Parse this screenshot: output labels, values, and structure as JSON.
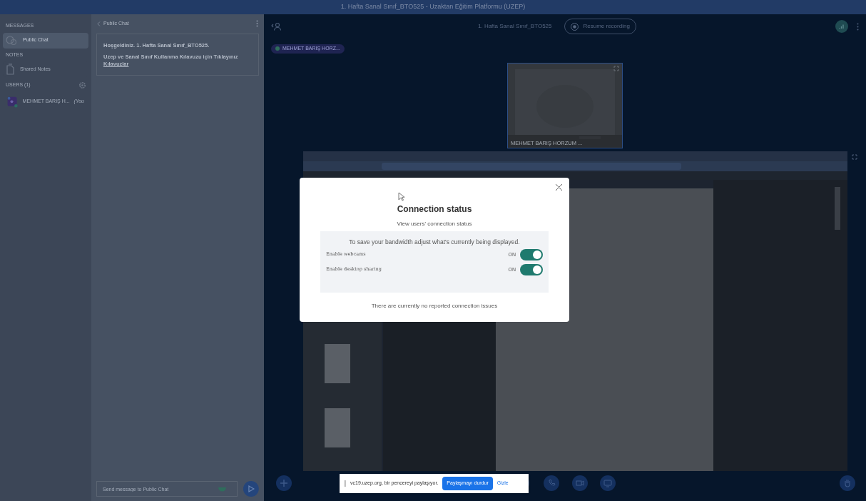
{
  "window": {
    "title": "1. Hafta Sanal Sınıf_BTO525 - Uzaktan Eğitim Platformu (UZEP)"
  },
  "sidebar": {
    "messages_heading": "MESSAGES",
    "messages": [
      {
        "label": "Public Chat",
        "selected": true
      }
    ],
    "notes_heading": "NOTES",
    "notes": [
      {
        "label": "Shared Notes",
        "selected": false
      }
    ],
    "users_heading": "USERS (1)",
    "users": [
      {
        "name": "MEHMET BARIŞ H...",
        "suffix": "(You"
      }
    ]
  },
  "chat": {
    "back_label": "Public Chat",
    "welcome": "Hoşgeldiniz. 1. Hafta Sanal Sınıf_BTO525.",
    "guide_text": "Uzep ve Sanal Sınıf Kullanma Kılavuzu için Tıklayınız",
    "guide_link": "Kılavuzlar",
    "input": {
      "placeholder": "Send message to Public Chat"
    }
  },
  "main": {
    "meeting_title": "1. Hafta Sanal Sınıf_BTO525",
    "recording_button": "Resume recording",
    "presenter_tag": "MEHMET BARIŞ HORZ...",
    "webcam": {
      "name": "MEHMET BARIŞ HORZUM ..."
    }
  },
  "modal": {
    "title": "Connection status",
    "subtitle": "View users' connection status",
    "note": "To save your bandwidth adjust what's currently being displayed.",
    "toggles": [
      {
        "label": "Enable webcams",
        "on": true,
        "state_text": "ON"
      },
      {
        "label": "Enable desktop sharing",
        "on": true,
        "state_text": "ON"
      }
    ],
    "footer": "There are currently no reported connection issues"
  },
  "share_bar": {
    "message": "vc19.uzep.org, bir pencereyi paylaşıyor.",
    "stop_button": "Paylaşmayı durdur",
    "hide_link": "Gizle"
  }
}
